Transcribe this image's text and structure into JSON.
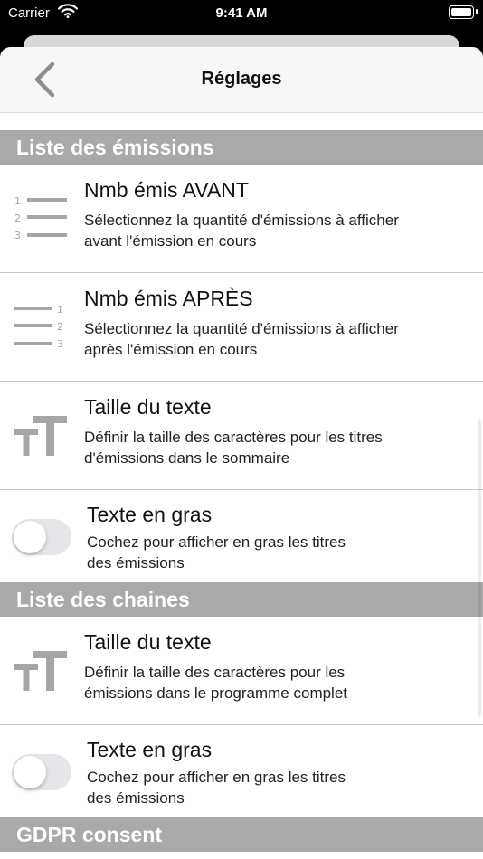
{
  "status_bar": {
    "carrier": "Carrier",
    "time": "9:41 AM"
  },
  "navbar": {
    "title": "Réglages",
    "back_icon": "chevron-left-icon"
  },
  "sections": [
    {
      "header": "Liste des émissions",
      "rows": [
        {
          "type": "setting",
          "icon": "numbered-list-left-icon",
          "title": "Nmb émis AVANT",
          "subtitle_line1": "Sélectionnez la quantité d'émissions à afficher",
          "subtitle_line2": "avant l'émission en cours"
        },
        {
          "type": "setting",
          "icon": "numbered-list-right-icon",
          "title": "Nmb émis APRÈS",
          "subtitle_line1": "Sélectionnez la quantité d'émissions à afficher",
          "subtitle_line2": "après l'émission en cours"
        },
        {
          "type": "setting",
          "icon": "text-size-icon",
          "title": "Taille du texte",
          "subtitle_line1": "Définir la taille des caractères pour les titres",
          "subtitle_line2": "d'émissions dans le sommaire"
        },
        {
          "type": "toggle",
          "title": "Texte en gras",
          "subtitle_line1": "Cochez pour afficher en gras les titres",
          "subtitle_line2": "des émissions",
          "on": false
        }
      ]
    },
    {
      "header": "Liste des chaines",
      "rows": [
        {
          "type": "setting",
          "icon": "text-size-icon",
          "title": "Taille du texte",
          "subtitle_line1": "Définir la taille des caractères pour les",
          "subtitle_line2": "émissions dans le programme complet"
        },
        {
          "type": "toggle",
          "title": "Texte en gras",
          "subtitle_line1": "Cochez pour afficher en gras les titres",
          "subtitle_line2": "des émissions",
          "on": false
        }
      ]
    },
    {
      "header": "GDPR consent",
      "rows": []
    }
  ],
  "colors": {
    "section_header_bg": "#a9a9a9",
    "icon_gray": "#a6a6a6",
    "toggle_off_bg": "#e5e5ea",
    "navbar_bg": "#f7f7f7"
  }
}
